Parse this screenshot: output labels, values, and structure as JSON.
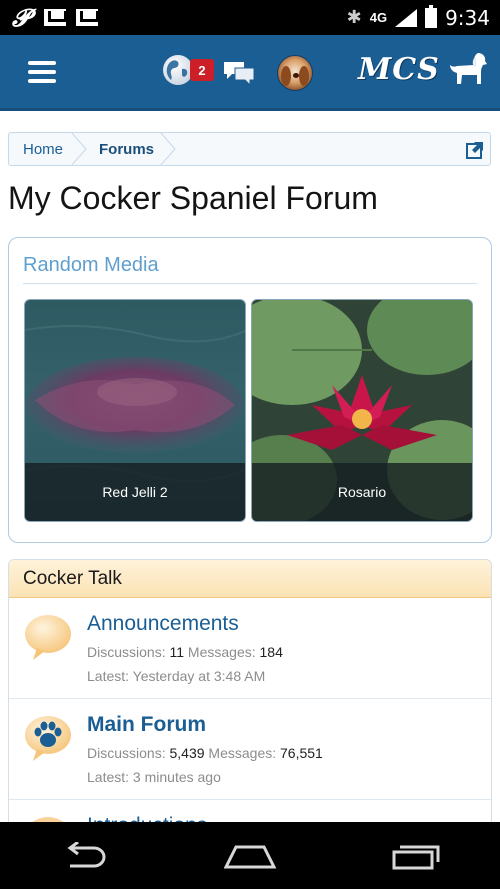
{
  "status_bar": {
    "left_icons": [
      "pinterest-icon",
      "gmail-icon",
      "gmail-icon"
    ],
    "network": "4G",
    "time": "9:34"
  },
  "header": {
    "notification_count": "2",
    "logo_text": "MCS"
  },
  "breadcrumb": {
    "items": [
      "Home",
      "Forums"
    ]
  },
  "page_title": "My Cocker Spaniel Forum",
  "random_media": {
    "title": "Random Media",
    "items": [
      {
        "caption": "Red Jelli 2"
      },
      {
        "caption": "Rosario"
      }
    ]
  },
  "category": {
    "title": "Cocker Talk",
    "forums": [
      {
        "title": "Announcements",
        "discussions_label": "Discussions:",
        "discussions": "11",
        "messages_label": "Messages:",
        "messages": "184",
        "latest": "Latest: Yesterday at 3:48 AM"
      },
      {
        "title": "Main Forum",
        "discussions_label": "Discussions:",
        "discussions": "5,439",
        "messages_label": "Messages:",
        "messages": "76,551",
        "latest": "Latest: 3 minutes ago"
      },
      {
        "title": "Introductions"
      }
    ]
  },
  "colors": {
    "header_bg": "#1b5e94",
    "link": "#1b5e94",
    "category_header": "#fbe2b3",
    "badge": "#cc1f27"
  }
}
